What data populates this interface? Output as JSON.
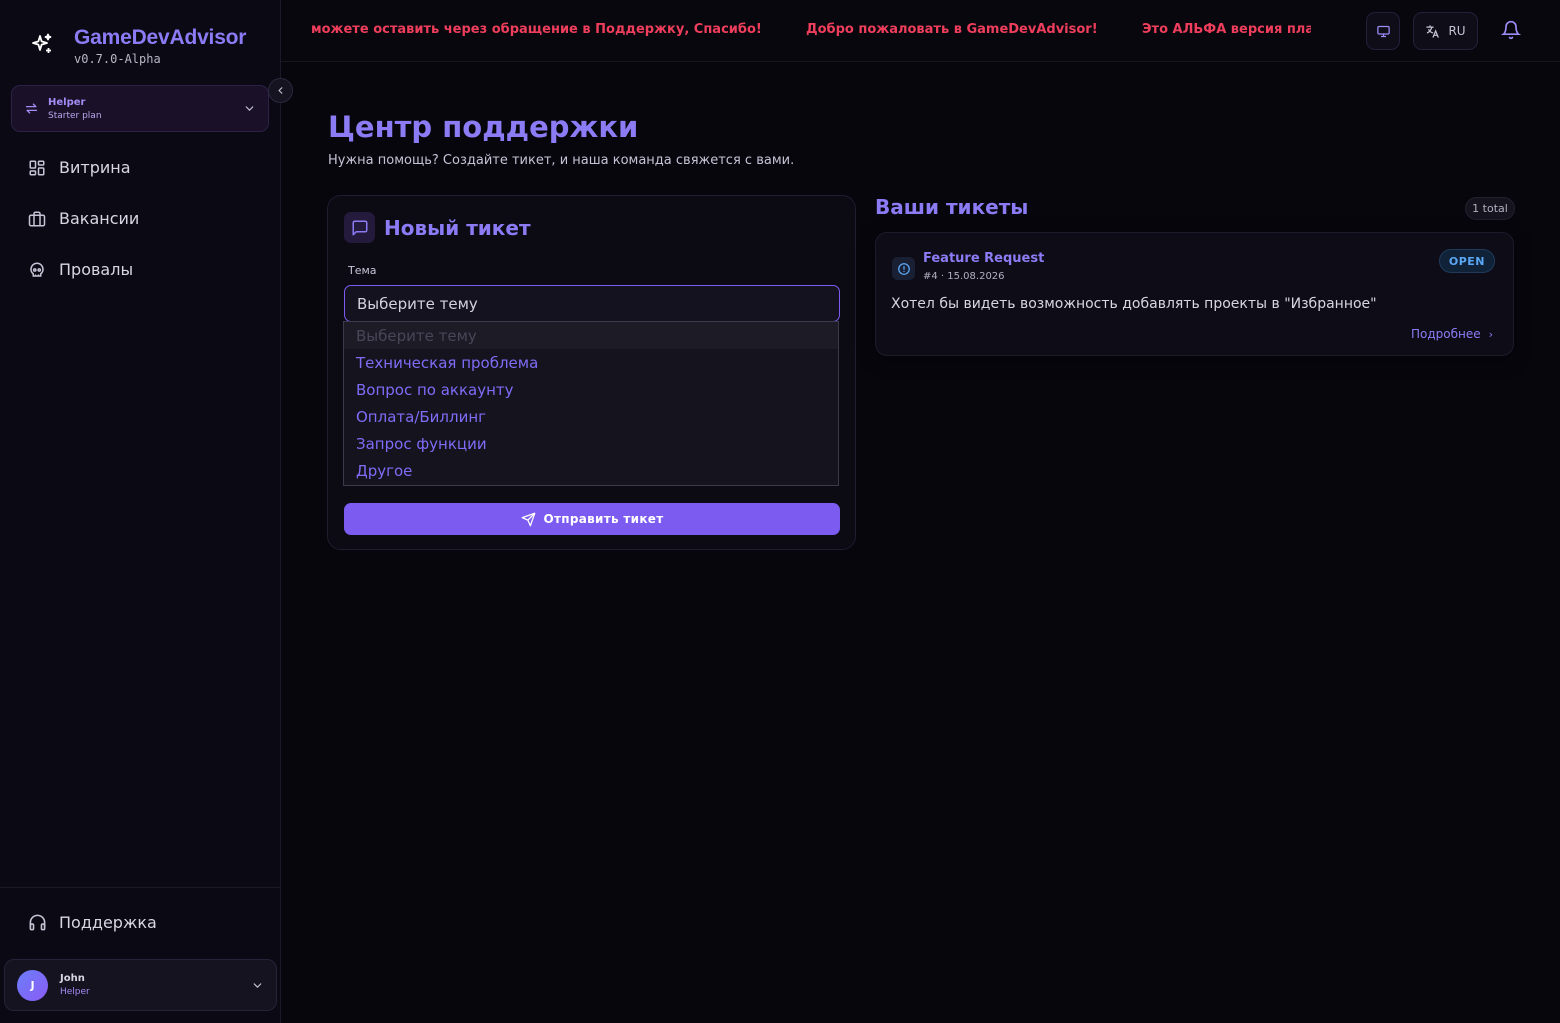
{
  "app": {
    "name": "GameDevAdvisor",
    "version": "v0.7.0-Alpha"
  },
  "workspace": {
    "name": "Helper",
    "plan": "Starter plan"
  },
  "nav": {
    "items": [
      {
        "label": "Витрина",
        "icon": "grid-icon"
      },
      {
        "label": "Вакансии",
        "icon": "briefcase-icon"
      },
      {
        "label": "Провалы",
        "icon": "skull-icon"
      }
    ],
    "support_label": "Поддержка"
  },
  "user": {
    "initial": "J",
    "name": "John",
    "role": "Helper"
  },
  "topbar": {
    "ticker": [
      "можете оставить через обращение в Поддержку, Спасибо!",
      "Добро пожаловать в GameDevAdvisor!",
      "Это АЛЬФА версия плат"
    ],
    "language": "RU"
  },
  "page": {
    "title": "Центр поддержки",
    "subtitle": "Нужна помощь? Создайте тикет, и наша команда свяжется с вами."
  },
  "new_ticket": {
    "title": "Новый тикет",
    "topic_label": "Тема",
    "topic_value": "Выберите тему",
    "options": [
      "Выберите тему",
      "Техническая проблема",
      "Вопрос по аккаунту",
      "Оплата/Биллинг",
      "Запрос функции",
      "Другое"
    ],
    "submit_label": "Отправить тикет"
  },
  "tickets": {
    "title": "Ваши тикеты",
    "total": "1 total",
    "items": [
      {
        "title": "Feature Request",
        "meta": "#4 · 15.08.2026",
        "status": "OPEN",
        "description": "Хотел бы видеть возможность добавлять проекты в \"Избранное\"",
        "more_label": "Подробнее",
        "more_arrow": "›"
      }
    ]
  },
  "colors": {
    "accent": "#8b7cf6",
    "button": "#7c5cf0",
    "ticker": "#ee3e5c",
    "status_open": "#5aa7f5",
    "background": "#07060d"
  }
}
